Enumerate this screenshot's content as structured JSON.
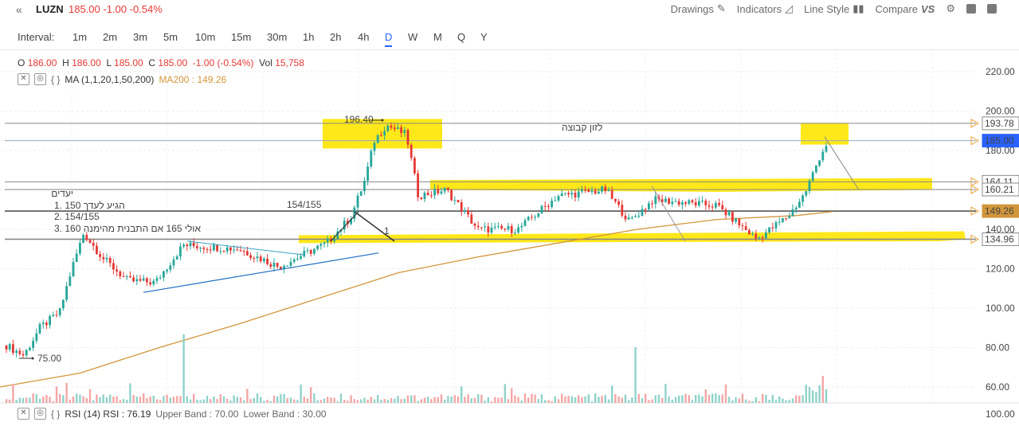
{
  "header": {
    "collapse_icon": "double-chevron-left-icon",
    "symbol": "LUZN",
    "price_change": "185.00 -1.00 -0.54%",
    "tools": [
      {
        "label": "Drawings",
        "icon": "pencil-icon"
      },
      {
        "label": "Indicators",
        "icon": "chart-area-icon"
      },
      {
        "label": "Line Style",
        "icon": "candles-icon"
      },
      {
        "label": "Compare",
        "icon": "versus-icon"
      }
    ]
  },
  "intervals": {
    "label": "Interval:",
    "items": [
      "1m",
      "2m",
      "3m",
      "5m",
      "10m",
      "15m",
      "30m",
      "1h",
      "2h",
      "4h",
      "D",
      "W",
      "M",
      "Q",
      "Y"
    ],
    "active": "D"
  },
  "legend": {
    "ohlc": {
      "o_label": "O",
      "o": "186.00",
      "h_label": "H",
      "h": "186.00",
      "l_label": "L",
      "l": "185.00",
      "c_label": "C",
      "c": "185.00",
      "chg": "-1.00 (-0.54%)",
      "vol_label": "Vol",
      "vol": "15,758"
    },
    "ma_text": "MA (1,1,20,1,50,200)",
    "ma200_text": "MA200 : 149.26",
    "rsi_text": "RSI (14) RSI : 76.19",
    "upper_text": "Upper Band : 70.00",
    "lower_text": "Lower Band : 30.00"
  },
  "colors": {
    "up": "#26a69a",
    "down": "#e53935",
    "ma200": "#d2963a",
    "highlight": "#ffe600",
    "blue_line": "#1e6fc5",
    "axis_blue": "#2962ff"
  },
  "annotations": {
    "targets_title": "יעדים",
    "target1": "1. 150 הגיע לעדך",
    "target2": "2. 154/155",
    "target3": "3. 160 אולי 165 אם התבנית מהימנה",
    "label_154": "154/155",
    "label_1": "1",
    "high_label": "196.40",
    "low_label": "75.00",
    "note": "לזון קבוצה"
  },
  "chart_data": {
    "type": "candlestick",
    "y_axis_ticks": [
      220,
      200,
      180,
      160,
      140,
      120,
      100,
      80,
      60
    ],
    "y_axis_tick_labels": [
      "220.00",
      "200.00",
      "180.00",
      "160.00",
      "140.00",
      "120.00",
      "100.00",
      "80.00",
      "60.00"
    ],
    "rsi_axis_label": "100.00",
    "price_levels": [
      {
        "value": 193.78,
        "label": "193.78"
      },
      {
        "value": 185.0,
        "label": "185.00",
        "current": true
      },
      {
        "value": 164.11,
        "label": "164.11"
      },
      {
        "value": 160.21,
        "label": "160.21"
      },
      {
        "value": 149.26,
        "label": "149.26",
        "ma200": true
      },
      {
        "value": 134.96,
        "label": "134.96"
      }
    ],
    "grid": true
  }
}
